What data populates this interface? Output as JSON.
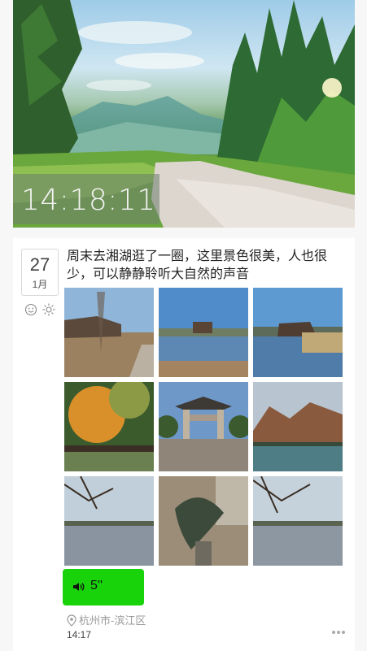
{
  "hero": {
    "clock": "14:18:11"
  },
  "entry": {
    "date_day": "27",
    "date_month": "1月",
    "mood_icon": "smiley-icon",
    "weather_icon": "sun-icon",
    "text": "周末去湘湖逛了一圈，这里景色很美，人也很少，可以静静聆听大自然的声音",
    "photo_count": 9,
    "voice": {
      "duration": "5''",
      "color": "#19d30a"
    },
    "location": "杭州市-滨江区",
    "time": "14:17"
  },
  "colors": {
    "voice_bg": "#19d30a",
    "location_text": "#9a9a9a"
  }
}
